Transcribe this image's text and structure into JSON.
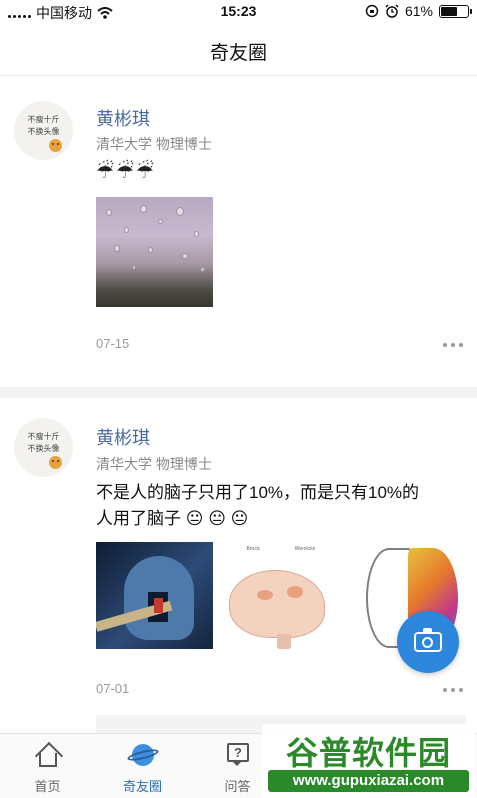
{
  "status_bar": {
    "carrier": "中国移动",
    "time": "15:23",
    "battery_percent": "61%",
    "battery_level": 0.61,
    "icons": [
      "signal-icon",
      "wifi-icon",
      "rotation-lock-icon",
      "alarm-icon",
      "battery-icon"
    ]
  },
  "nav": {
    "title": "奇友圈"
  },
  "posts": [
    {
      "avatar_text": [
        "不瘦十斤",
        "不换头像"
      ],
      "name": "黄彬琪",
      "meta": "清华大学 物理博士",
      "emoji": [
        "☔",
        "☔",
        "☔"
      ],
      "date": "07-15",
      "images": [
        "rain-window-photo"
      ]
    },
    {
      "avatar_text": [
        "不瘦十斤",
        "不换头像"
      ],
      "name": "黄彬琪",
      "meta": "清华大学 物理博士",
      "text_line1": "不是人的脑子只用了10%，而是只有10%的",
      "text_line2": "人用了脑子",
      "emoji": [
        "😐",
        "😐",
        "😐"
      ],
      "date": "07-01",
      "images": [
        "head-door-photo",
        "brain-diagram-photo",
        "neural-brain-photo"
      ],
      "brain_labels": [
        "Broca",
        "Wernicke"
      ]
    }
  ],
  "fab": {
    "icon": "camera-icon"
  },
  "tabs": [
    {
      "label": "首页",
      "icon": "home-icon",
      "active": false
    },
    {
      "label": "奇友圈",
      "icon": "planet-icon",
      "active": true
    },
    {
      "label": "问答",
      "icon": "question-icon",
      "active": false
    }
  ],
  "watermark": {
    "logo": "谷普软件园",
    "url": "www.gupuxiazai.com"
  },
  "colors": {
    "accent": "#2b86dc",
    "name_blue": "#4a6aa2",
    "tab_active": "#2b6fb8"
  }
}
